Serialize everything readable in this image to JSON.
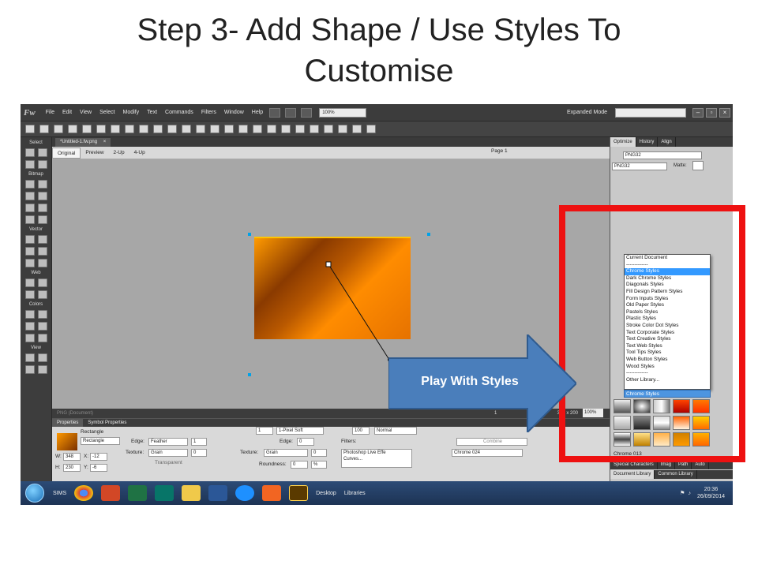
{
  "slide": {
    "title_line1": "Step 3- Add Shape / Use Styles To",
    "title_line2": "Customise"
  },
  "app": {
    "logo": "Fw",
    "menu": [
      "File",
      "Edit",
      "View",
      "Select",
      "Modify",
      "Text",
      "Commands",
      "Filters",
      "Window",
      "Help"
    ],
    "zoom": "100%",
    "workspace_mode": "Expanded Mode"
  },
  "tools_panel": {
    "sections": [
      "Select",
      "Bitmap",
      "Vector",
      "Web",
      "Colors",
      "View"
    ]
  },
  "document": {
    "tab_title": "*Untitled-1.fw.png",
    "tab_close": "×",
    "view_modes": [
      "Original",
      "Preview",
      "2-Up",
      "4-Up"
    ],
    "page_label": "Page 1",
    "status_left": "PNG (Document)",
    "page_number": "1",
    "canvas_size": "300 x 200",
    "zoom_level": "100%"
  },
  "properties": {
    "tabs": [
      "Properties",
      "Symbol Properties"
    ],
    "object_type": "Rectangle",
    "object_name": "Rectangle",
    "edge_label": "Edge:",
    "edge_value": "Feather",
    "edge_amount": "1",
    "texture_label": "Texture:",
    "texture_value": "Grain",
    "texture_amount": "0",
    "transparent_label": "Transparent",
    "w_label": "W:",
    "w_value": "348",
    "h_label": "H:",
    "h_value": "230",
    "x_label": "X:",
    "x_value": "-12",
    "y_label": "Y:",
    "y_value": "-6",
    "stroke_size": "1",
    "stroke_type": "1-Pixel Soft",
    "stroke_edge_label": "Edge:",
    "stroke_edge_value": "0",
    "stroke_texture_label": "Texture:",
    "stroke_texture_value": "Grain",
    "stroke_texture_amount": "0",
    "roundness_label": "Roundness:",
    "roundness_value": "0",
    "roundness_unit": "%",
    "opacity": "100",
    "blend_mode": "Normal",
    "filters_label": "Filters:",
    "filters": [
      "Photoshop Live Effe",
      "Curves..."
    ],
    "combine_label": "Combine",
    "style_value": "Chrome 024"
  },
  "right_panel": {
    "tabs": [
      "Optimize",
      "History",
      "Align"
    ],
    "format_1": "PNG32",
    "format_2": "PNG32",
    "matte_label": "Matte:",
    "styles_dropdown": [
      "Current Document",
      "-------------",
      "Chrome Styles",
      "Dark Chrome Styles",
      "Diagonals Styles",
      "Fill Design Pattern Styles",
      "Form Inputs Styles",
      "Old Paper Styles",
      "Pastels Styles",
      "Plastic Styles",
      "Stroke Color Dot Styles",
      "Text Corporate Styles",
      "Text Creative Styles",
      "Text Web Styles",
      "Tool Tips Styles",
      "Web Button Styles",
      "Wood Styles",
      "-------------",
      "Other Library..."
    ],
    "styles_selected": "Chrome Styles",
    "selected_style": "Chrome 013",
    "bottom_tabs_1": [
      "Special Characters",
      "Imag",
      "Path",
      "Auto"
    ],
    "bottom_tabs_2": [
      "Document Library",
      "Common Library"
    ]
  },
  "taskbar": {
    "items": [
      "SIMS",
      "Desktop",
      "Libraries"
    ],
    "time": "20:36",
    "date": "26/09/2014"
  },
  "annotation": {
    "callout_text": "Play With Styles",
    "callout_color": "#4a7ebb",
    "highlight_color": "#ee1111"
  }
}
